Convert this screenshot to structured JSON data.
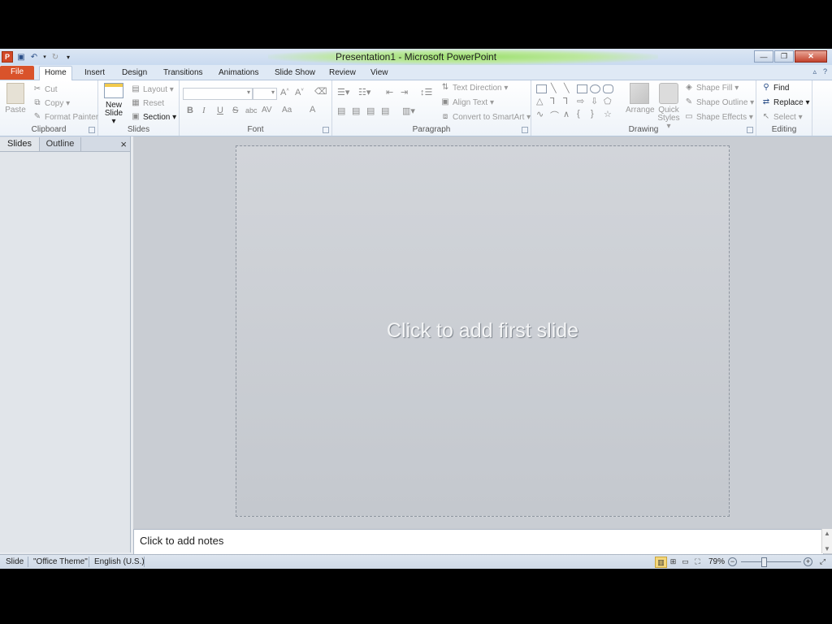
{
  "window": {
    "title": "Presentation1 - Microsoft PowerPoint"
  },
  "tabs": [
    {
      "label": "File"
    },
    {
      "label": "Home"
    },
    {
      "label": "Insert"
    },
    {
      "label": "Design"
    },
    {
      "label": "Transitions"
    },
    {
      "label": "Animations"
    },
    {
      "label": "Slide Show"
    },
    {
      "label": "Review"
    },
    {
      "label": "View"
    }
  ],
  "ribbon": {
    "clipboard": {
      "label": "Clipboard",
      "paste": "Paste",
      "cut": "Cut",
      "copy": "Copy",
      "format_painter": "Format Painter"
    },
    "slides": {
      "label": "Slides",
      "new_slide_1": "New",
      "new_slide_2": "Slide",
      "layout": "Layout",
      "reset": "Reset",
      "section": "Section"
    },
    "font": {
      "label": "Font",
      "bold": "B",
      "italic": "I",
      "underline": "U",
      "strike": "S",
      "shadow": "abc",
      "spacing": "AV",
      "case": "Aa",
      "color": "A"
    },
    "paragraph": {
      "label": "Paragraph",
      "text_direction": "Text Direction",
      "align_text": "Align Text",
      "convert_smartart": "Convert to SmartArt"
    },
    "drawing": {
      "label": "Drawing",
      "arrange": "Arrange",
      "quick_styles_1": "Quick",
      "quick_styles_2": "Styles",
      "shape_fill": "Shape Fill",
      "shape_outline": "Shape Outline",
      "shape_effects": "Shape Effects"
    },
    "editing": {
      "label": "Editing",
      "find": "Find",
      "replace": "Replace",
      "select": "Select"
    }
  },
  "left_pane": {
    "tab_slides": "Slides",
    "tab_outline": "Outline",
    "close": "×"
  },
  "slide": {
    "placeholder": "Click to add first slide"
  },
  "notes": {
    "placeholder": "Click to add notes"
  },
  "status": {
    "slide": "Slide",
    "theme": "\"Office Theme\"",
    "language": "English (U.S.)",
    "zoom": "79%",
    "zoom_value_percent": 79
  },
  "colors": {
    "file_tab": "#d9532b",
    "title_glow": "#9be06b",
    "slide_bg": "#c9cdd3"
  }
}
